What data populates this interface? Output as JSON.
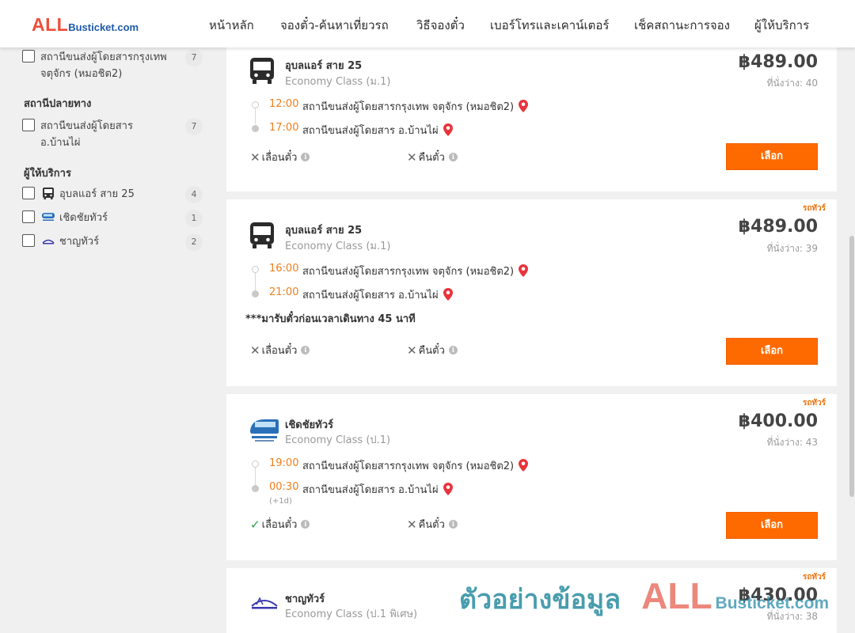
{
  "brand": {
    "logo_main": "ALL",
    "logo_rest": "Busticket.com"
  },
  "nav": {
    "home": "หน้าหลัก",
    "search": "จองตั๋ว-ค้นหาเที่ยวรถ",
    "howto": "วิธีจองตั๋ว",
    "contact": "เบอร์โทรและเคาน์เตอร์",
    "status": "เช็คสถานะการจอง",
    "operators": "ผู้ให้บริการ"
  },
  "sidebar": {
    "origin_item": {
      "label_line1": "สถานีขนส่งผู้โดยสารกรุงเทพ",
      "label_line2": "จตุจักร (หมอชิต2)",
      "count": "7"
    },
    "destination_title": "สถานีปลายทาง",
    "destination_item": {
      "label_line1": "สถานีขนส่งผู้โดยสาร",
      "label_line2": "อ.บ้านไผ่",
      "count": "7"
    },
    "operators_title": "ผู้ให้บริการ",
    "operators": [
      {
        "label": "อุบลแอร์ สาย 25",
        "count": "4",
        "icon": "bus-icon"
      },
      {
        "label": "เชิดชัยทัวร์",
        "count": "1",
        "icon": "cherdchai-logo"
      },
      {
        "label": "ชาญทัวร์",
        "count": "2",
        "icon": "chan-tour-logo"
      }
    ]
  },
  "common": {
    "select_label": "เลือก",
    "change_ticket": "เลื่อนตั๋ว",
    "refund_ticket": "คืนตั๋ว",
    "info_glyph": "i",
    "x_glyph": "✕",
    "check_glyph": "✓"
  },
  "trips": [
    {
      "operator": "อุบลแอร์ สาย 25",
      "class": "Economy Class (ม.1)",
      "price": "฿489.00",
      "seats": "ที่นั่งว่าง: 40",
      "tag": "",
      "depart_time": "12:00",
      "depart_station": "สถานีขนส่งผู้โดยสารกรุงเทพ จตุจักร (หมอชิต2)",
      "arrive_time": "17:00",
      "arrive_station": "สถานีขนส่งผู้โดยสาร อ.บ้านไผ่",
      "change_allowed": false,
      "refund_allowed": false
    },
    {
      "operator": "อุบลแอร์ สาย 25",
      "class": "Economy Class (ม.1)",
      "price": "฿489.00",
      "seats": "ที่นั่งว่าง: 39",
      "tag": "รถทัวร์",
      "depart_time": "16:00",
      "depart_station": "สถานีขนส่งผู้โดยสารกรุงเทพ จตุจักร (หมอชิต2)",
      "arrive_time": "21:00",
      "arrive_station": "สถานีขนส่งผู้โดยสาร อ.บ้านไผ่",
      "note": "***มารับตั๋วก่อนเวลาเดินทาง 45 นาที",
      "change_allowed": false,
      "refund_allowed": false
    },
    {
      "operator": "เชิดชัยทัวร์",
      "class": "Economy Class (ป.1)",
      "price": "฿400.00",
      "seats": "ที่นั่งว่าง: 43",
      "tag": "รถทัวร์",
      "depart_time": "19:00",
      "depart_station": "สถานีขนส่งผู้โดยสารกรุงเทพ จตุจักร (หมอชิต2)",
      "arrive_time": "00:30",
      "arrive_station": "สถานีขนส่งผู้โดยสาร อ.บ้านไผ่",
      "plus_day": "(+1d)",
      "change_allowed": true,
      "refund_allowed": false
    },
    {
      "operator": "ชาญทัวร์",
      "class": "Economy Class (ป.1 พิเศษ)",
      "price": "฿430.00",
      "seats": "ที่นั่งว่าง: 38",
      "tag": "รถทัวร์"
    }
  ],
  "watermark": {
    "text": "ตัวอย่างข้อมูล",
    "brand_main": "ALL",
    "brand_rest": "Busticket.com"
  },
  "colors": {
    "accent": "#ff6a00",
    "time": "#f07e1d",
    "pin": "#e8343c",
    "tag": "#e8720c"
  }
}
